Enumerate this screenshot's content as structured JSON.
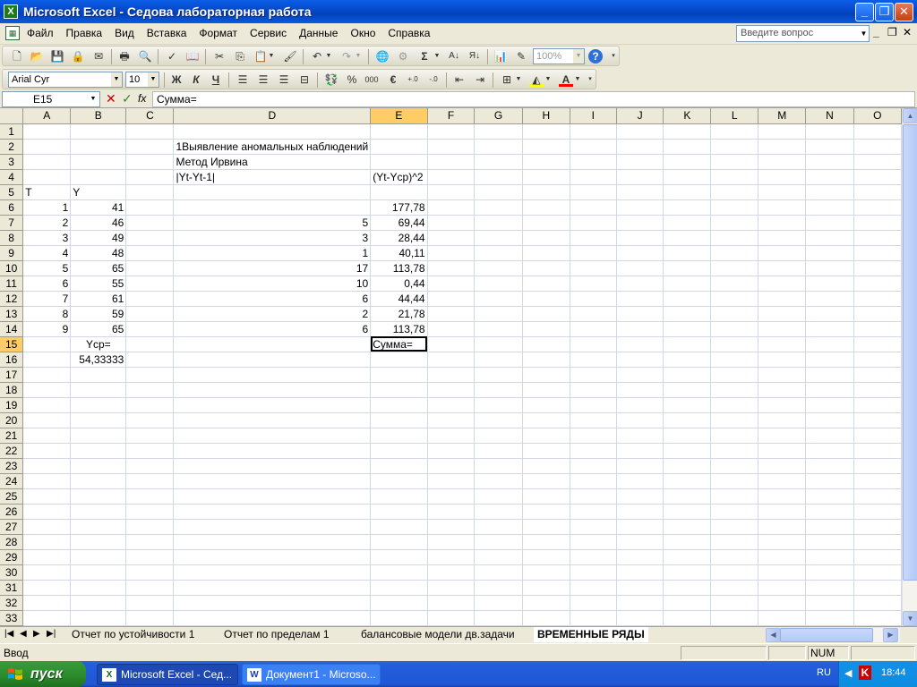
{
  "window": {
    "title": "Microsoft Excel - Седова лабораторная работа",
    "icon": "excel-icon"
  },
  "menubar": {
    "items": [
      "Файл",
      "Правка",
      "Вид",
      "Вставка",
      "Формат",
      "Сервис",
      "Данные",
      "Окно",
      "Справка"
    ],
    "help_placeholder": "Введите вопрос"
  },
  "toolbar_standard": {
    "zoom": "100%"
  },
  "toolbar_format": {
    "font": "Arial Cyr",
    "size": "10",
    "bold": "Ж",
    "italic": "К",
    "underline": "Ч"
  },
  "formula_bar": {
    "name_box": "E15",
    "fx": "fx",
    "content": "Сумма="
  },
  "columns": [
    "A",
    "B",
    "C",
    "D",
    "E",
    "F",
    "G",
    "H",
    "I",
    "J",
    "K",
    "L",
    "M",
    "N",
    "O"
  ],
  "active_col": "E",
  "active_row": 15,
  "rows": [
    {
      "n": 1,
      "c": {}
    },
    {
      "n": 2,
      "c": {
        "D": "1Выявление аномальных наблюдений"
      }
    },
    {
      "n": 3,
      "c": {
        "D": "Метод Ирвина"
      }
    },
    {
      "n": 4,
      "c": {
        "D": "|Yt-Yt-1|",
        "E": "(Yt-Yср)^2"
      }
    },
    {
      "n": 5,
      "c": {
        "A": "T",
        "B": "Y"
      }
    },
    {
      "n": 6,
      "c": {
        "A": "1",
        "B": "41",
        "E": "177,78"
      }
    },
    {
      "n": 7,
      "c": {
        "A": "2",
        "B": "46",
        "D": "5",
        "E": "69,44"
      }
    },
    {
      "n": 8,
      "c": {
        "A": "3",
        "B": "49",
        "D": "3",
        "E": "28,44"
      }
    },
    {
      "n": 9,
      "c": {
        "A": "4",
        "B": "48",
        "D": "1",
        "E": "40,11"
      }
    },
    {
      "n": 10,
      "c": {
        "A": "5",
        "B": "65",
        "D": "17",
        "E": "113,78"
      }
    },
    {
      "n": 11,
      "c": {
        "A": "6",
        "B": "55",
        "D": "10",
        "E": "0,44"
      }
    },
    {
      "n": 12,
      "c": {
        "A": "7",
        "B": "61",
        "D": "6",
        "E": "44,44"
      }
    },
    {
      "n": 13,
      "c": {
        "A": "8",
        "B": "59",
        "D": "2",
        "E": "21,78"
      }
    },
    {
      "n": 14,
      "c": {
        "A": "9",
        "B": "65",
        "D": "6",
        "E": "113,78"
      }
    },
    {
      "n": 15,
      "c": {
        "B": "Yср=",
        "E": "Сумма="
      }
    },
    {
      "n": 16,
      "c": {
        "B": "54,33333"
      }
    },
    {
      "n": 17,
      "c": {}
    },
    {
      "n": 18,
      "c": {}
    },
    {
      "n": 19,
      "c": {}
    },
    {
      "n": 20,
      "c": {}
    },
    {
      "n": 21,
      "c": {}
    },
    {
      "n": 22,
      "c": {}
    },
    {
      "n": 23,
      "c": {}
    },
    {
      "n": 24,
      "c": {}
    },
    {
      "n": 25,
      "c": {}
    },
    {
      "n": 26,
      "c": {}
    },
    {
      "n": 27,
      "c": {}
    },
    {
      "n": 28,
      "c": {}
    },
    {
      "n": 29,
      "c": {}
    },
    {
      "n": 30,
      "c": {}
    },
    {
      "n": 31,
      "c": {}
    },
    {
      "n": 32,
      "c": {}
    },
    {
      "n": 33,
      "c": {}
    }
  ],
  "sheet_tabs": [
    "Отчет по устойчивости 1",
    "Отчет по пределам 1",
    "балансовые модели дв.задачи",
    "ВРЕМЕННЫЕ РЯДЫ"
  ],
  "active_tab": "ВРЕМЕННЫЕ РЯДЫ",
  "status": {
    "mode": "Ввод",
    "num": "NUM"
  },
  "taskbar": {
    "start": "пуск",
    "tasks": [
      "Microsoft Excel - Сед...",
      "Документ1 - Microso..."
    ],
    "lang": "RU",
    "clock": "18:44"
  },
  "colors": {
    "active_header": "#ffcc66",
    "titlebar": "#0548c8",
    "grid": "#d0d7e5"
  }
}
